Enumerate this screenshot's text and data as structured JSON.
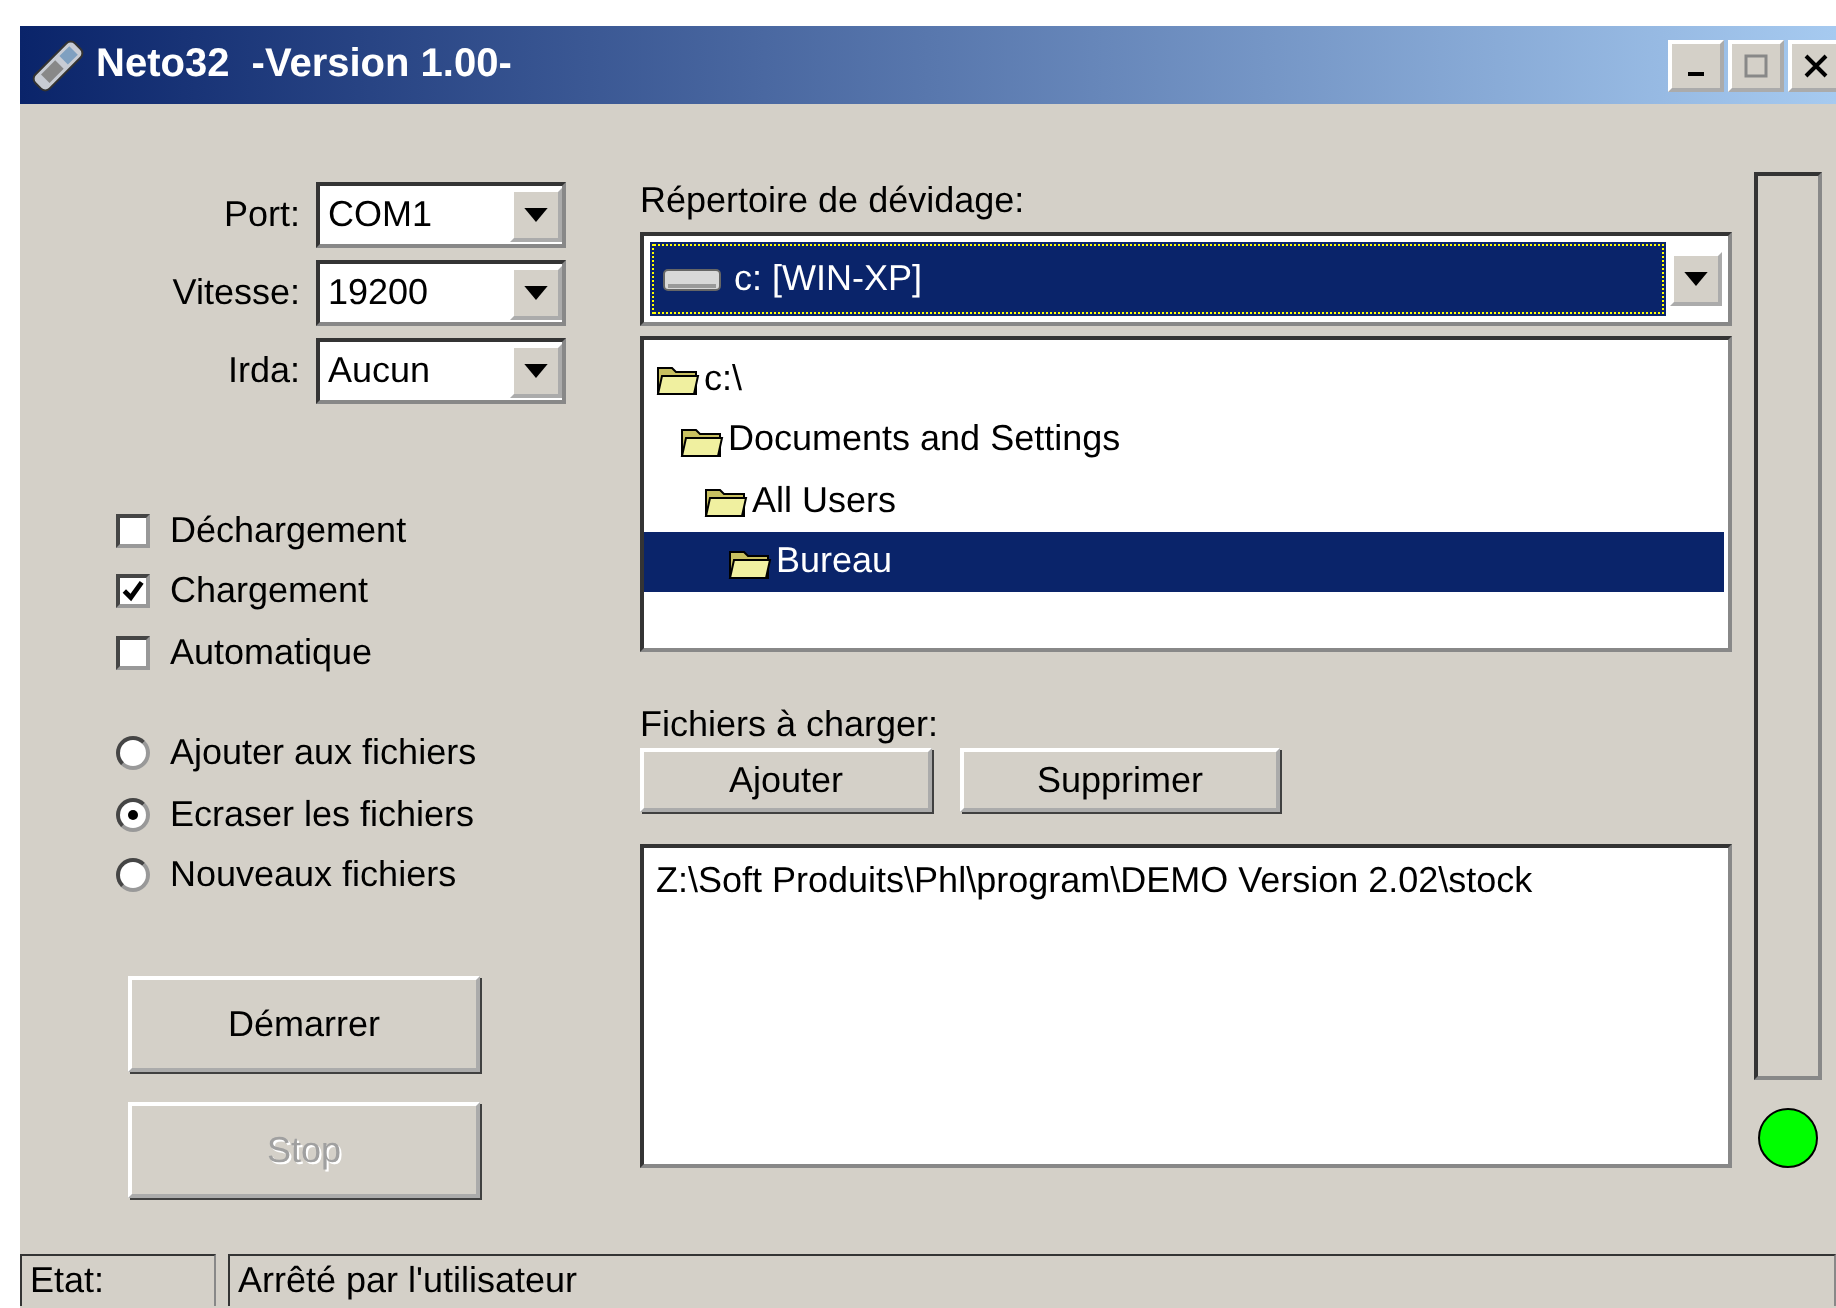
{
  "window": {
    "title": "Neto32  -Version 1.00-"
  },
  "settings": [
    {
      "label": "Port:",
      "value": "COM1"
    },
    {
      "label": "Vitesse:",
      "value": "19200"
    },
    {
      "label": "Irda:",
      "value": "Aucun"
    }
  ],
  "options": [
    {
      "label": "Déchargement",
      "checked": false
    },
    {
      "label": "Chargement",
      "checked": true
    },
    {
      "label": "Automatique",
      "checked": false
    }
  ],
  "modes": [
    {
      "label": "Ajouter aux fichiers",
      "selected": false
    },
    {
      "label": "Ecraser les fichiers",
      "selected": true
    },
    {
      "label": "Nouveaux fichiers",
      "selected": false
    }
  ],
  "actions": [
    {
      "label": "Démarrer",
      "disabled": false
    },
    {
      "label": "Stop",
      "disabled": true
    }
  ],
  "directory": {
    "label": "Répertoire de dévidage:",
    "drive": "c: [WIN-XP]",
    "tree": [
      {
        "label": "c:\\",
        "selected": false,
        "children": [
          {
            "label": "Documents and Settings",
            "selected": false,
            "children": [
              {
                "label": "All Users",
                "selected": false,
                "children": [
                  {
                    "label": "Bureau",
                    "selected": true
                  }
                ]
              }
            ]
          }
        ]
      }
    ]
  },
  "files": {
    "label": "Fichiers à charger:",
    "buttons": [
      "Ajouter",
      "Supprimer"
    ],
    "items": [
      "Z:\\Soft Produits\\Phl\\program\\DEMO Version 2.02\\stock"
    ]
  },
  "status_light": {
    "on": true
  },
  "status_bar": {
    "label": "Etat:",
    "message": "Arrêté par l'utilisateur"
  }
}
